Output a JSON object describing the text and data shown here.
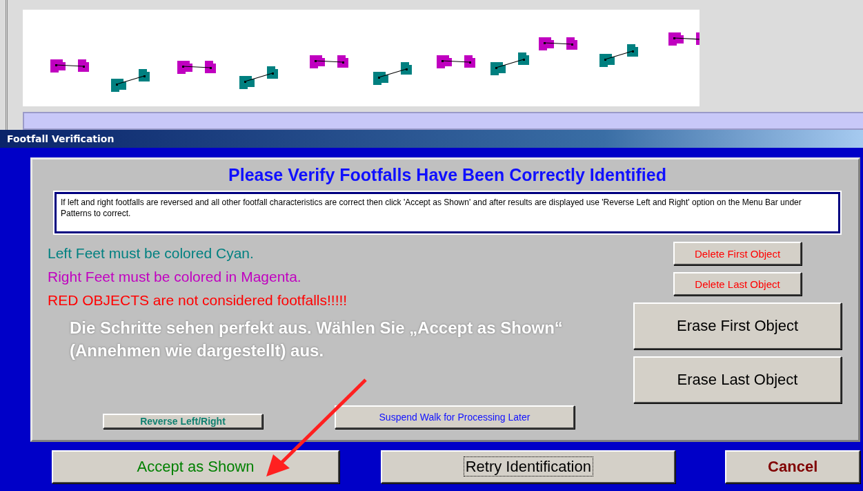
{
  "dialog": {
    "title": "Footfall Verification"
  },
  "heading": "Please Verify Footfalls Have Been Correctly Identified",
  "message": "If left and right footfalls are reversed and all other footfall characteristics are correct then click 'Accept as Shown' and after results are displayed use 'Reverse Left and Right' option on the Menu Bar under Patterns to correct.",
  "legend": [
    {
      "kind": "left",
      "text": "Left Feet must be colored Cyan."
    },
    {
      "kind": "right",
      "text": "Right Feet must be colored in Magenta."
    },
    {
      "kind": "red",
      "text": "RED OBJECTS are not considered footfalls!!!!!"
    }
  ],
  "annotation": "Die Schritte sehen perfekt aus. Wählen Sie „Accept as Shown“ (Annehmen wie dargestellt) aus.",
  "small_buttons": [
    {
      "kind": "teal",
      "label": "Reverse Left/Right"
    },
    {
      "kind": "blue",
      "label": "Suspend Walk for Processing Later"
    }
  ],
  "delete_buttons": [
    "Delete First Object",
    "Delete Last Object"
  ],
  "erase_buttons": [
    "Erase First Object",
    "Erase Last Object"
  ],
  "bottom_buttons": [
    {
      "kind": "accept",
      "label": "Accept as Shown",
      "focused": false
    },
    {
      "kind": "retry",
      "label": "Retry Identification",
      "focused": true
    },
    {
      "kind": "cancel",
      "label": "Cancel",
      "focused": false
    }
  ]
}
